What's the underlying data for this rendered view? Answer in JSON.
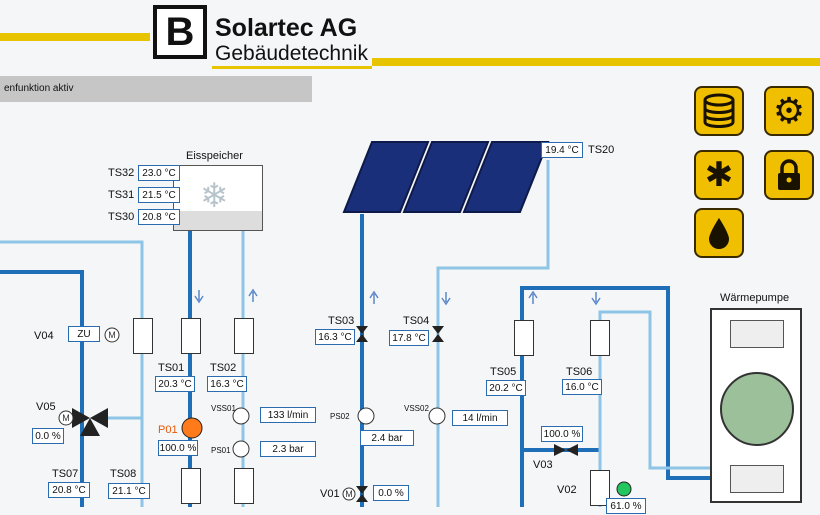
{
  "header": {
    "logo_letter": "B",
    "company": "Solartec AG",
    "department": "Gebäudetechnik"
  },
  "status_bar": {
    "text": "enfunktion aktiv"
  },
  "eisspeicher": {
    "title": "Eisspeicher",
    "sensors": [
      {
        "label": "TS32",
        "value": "23.0 °C"
      },
      {
        "label": "TS31",
        "value": "21.5 °C"
      },
      {
        "label": "TS30",
        "value": "20.8 °C"
      }
    ]
  },
  "collector": {
    "label": "TS20",
    "value": "19.4 °C"
  },
  "waermepumpe": {
    "title": "Wärmepumpe"
  },
  "sensors": {
    "ts01": {
      "label": "TS01",
      "value": "20.3 °C"
    },
    "ts02": {
      "label": "TS02",
      "value": "16.3 °C"
    },
    "ts03": {
      "label": "TS03",
      "value": "16.3 °C"
    },
    "ts04": {
      "label": "TS04",
      "value": "17.8 °C"
    },
    "ts05": {
      "label": "TS05",
      "value": "20.2 °C"
    },
    "ts06": {
      "label": "TS06",
      "value": "16.0 °C"
    },
    "ts07": {
      "label": "TS07",
      "value": "20.8 °C"
    },
    "ts08": {
      "label": "TS08",
      "value": "21.1 °C"
    }
  },
  "flow": {
    "vss01": {
      "label": "VSS01",
      "value": "133 l/min"
    },
    "vss02": {
      "label": "VSS02",
      "value": "14 l/min"
    }
  },
  "pressure": {
    "ps01": {
      "label": "PS01",
      "value": "2.3 bar"
    },
    "ps02": {
      "label": "PS02",
      "value": "2.4 bar"
    }
  },
  "valves": {
    "v04": {
      "label": "V04",
      "state": "ZU"
    },
    "v05": {
      "label": "V05",
      "value": "0.0 %"
    },
    "v01": {
      "label": "V01",
      "value": "0.0 %"
    },
    "v03": {
      "label": "V03",
      "value": "100.0 %"
    },
    "v02": {
      "label": "V02",
      "value": "61.0 %"
    }
  },
  "pump_p01": {
    "label": "P01",
    "value": "100.0 %"
  },
  "nav_tiles": [
    "database-icon",
    "gear-icon",
    "snowflake-icon",
    "lock-icon",
    "water-drop-icon"
  ],
  "colors": {
    "accent": "#f0c000",
    "pipe_warm": "#1e6fb8",
    "pipe_cool": "#8ec5e6"
  }
}
